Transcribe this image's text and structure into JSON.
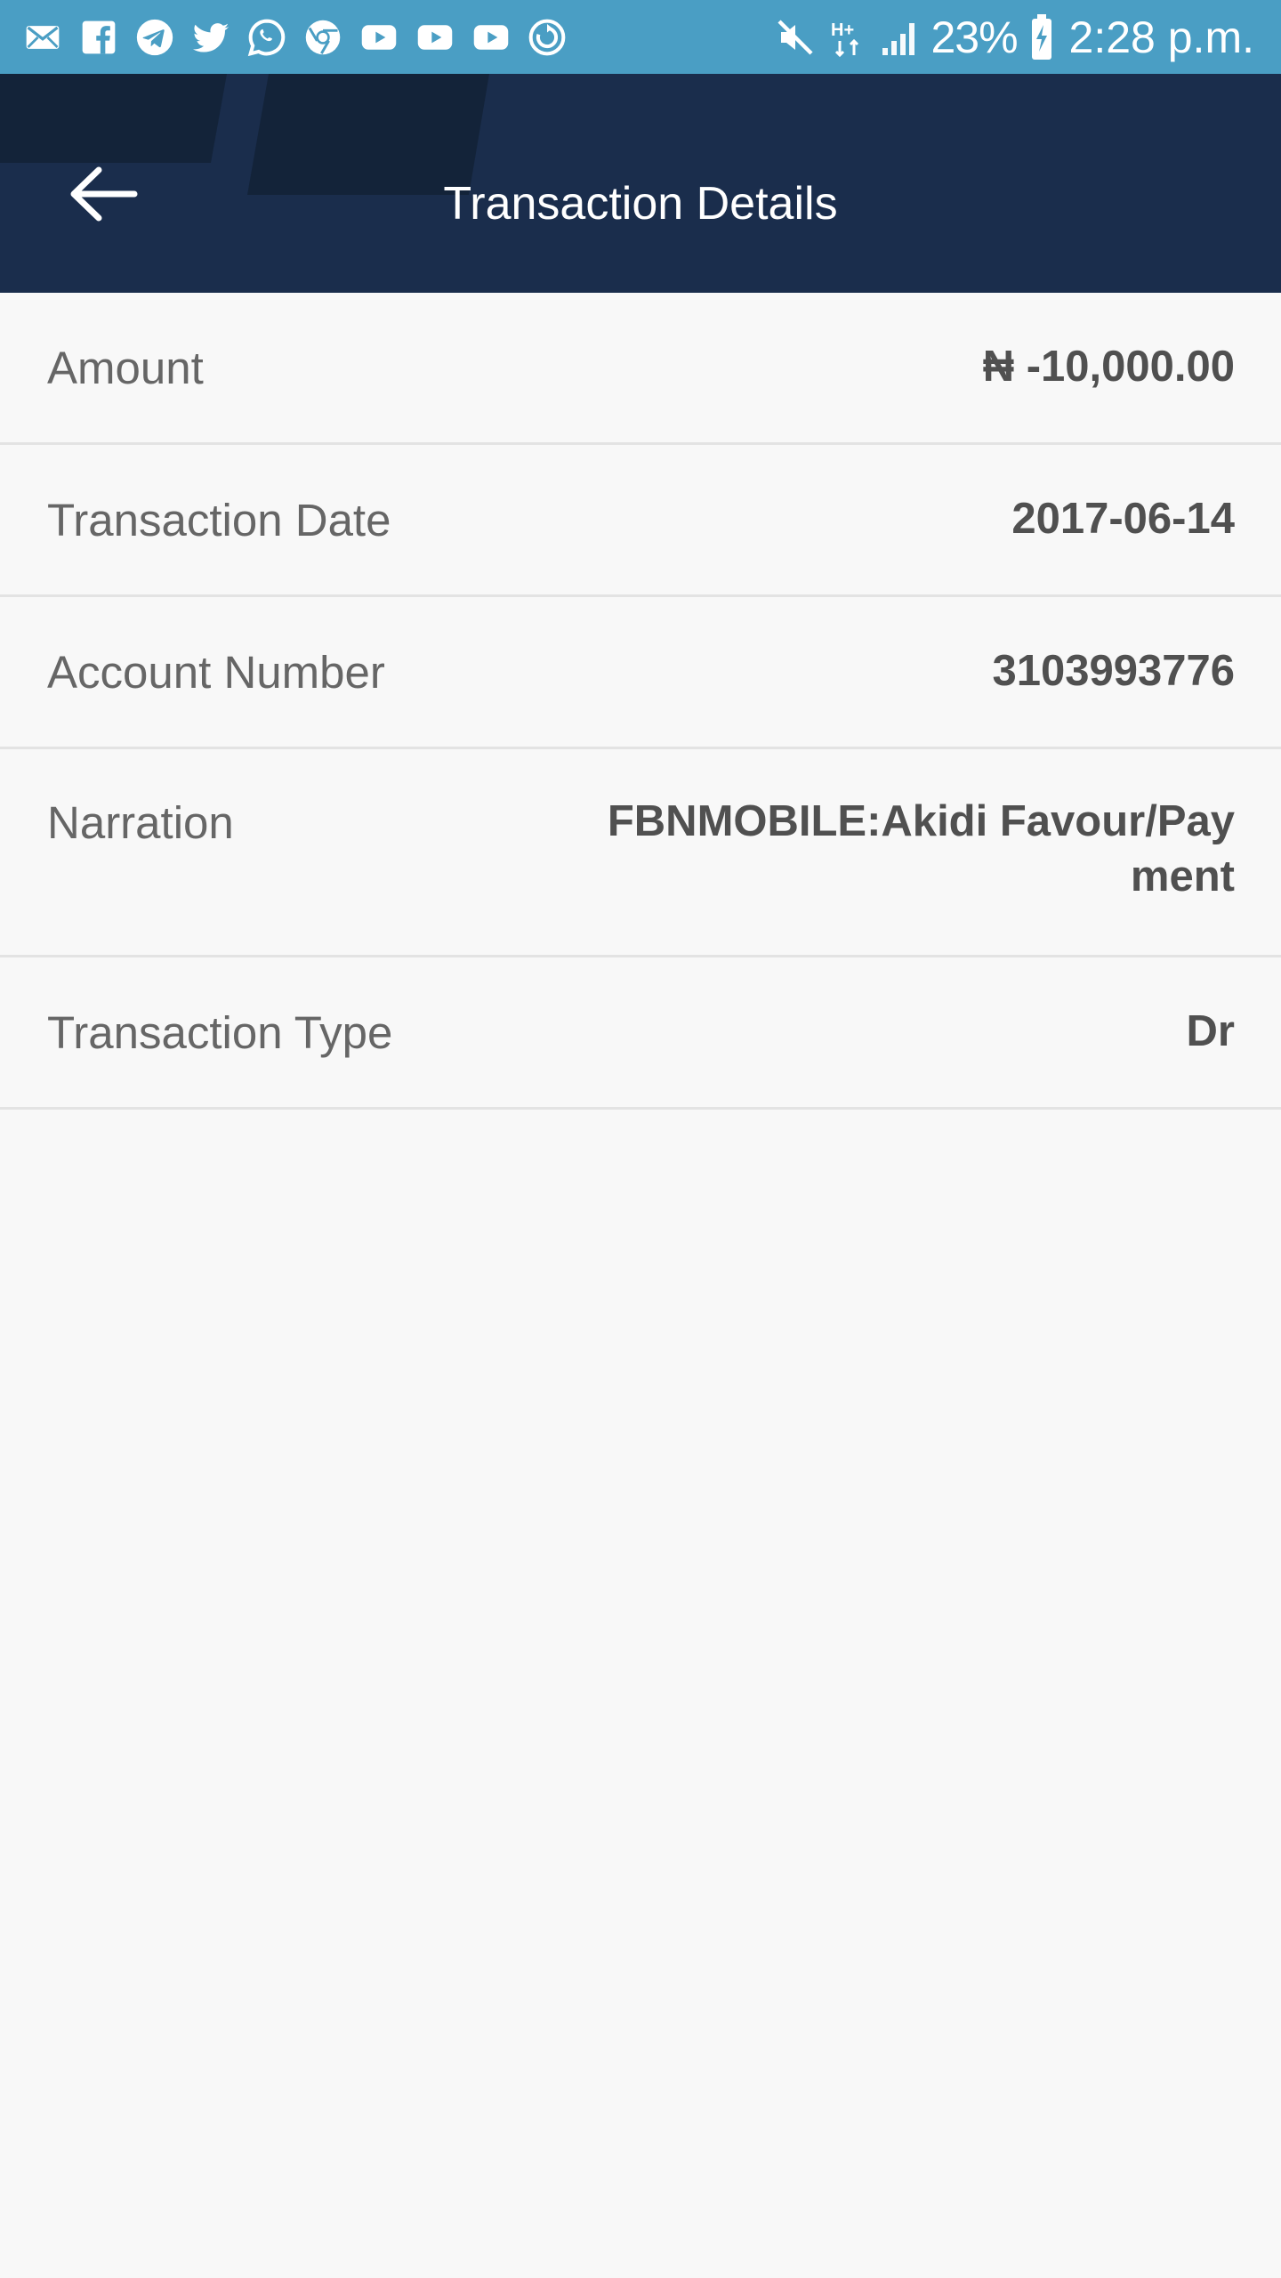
{
  "status_bar": {
    "notification_icons": [
      "email-icon",
      "facebook-icon",
      "telegram-icon",
      "twitter-icon",
      "whatsapp-icon",
      "chrome-icon",
      "youtube-icon",
      "youtube-icon",
      "youtube-icon",
      "sync-icon"
    ],
    "battery_percent": "23%",
    "time": "2:28 p.m."
  },
  "header": {
    "title": "Transaction Details",
    "back_icon": "back-arrow-icon",
    "background_color": "#1a2d4c"
  },
  "details": [
    {
      "label": "Amount",
      "value": "₦ -10,000.00"
    },
    {
      "label": "Transaction Date",
      "value": "2017-06-14"
    },
    {
      "label": "Account Number",
      "value": "3103993776"
    },
    {
      "label": "Narration",
      "value_lines": [
        "FBNMOBILE:Akidi Favour/Pay",
        "ment"
      ]
    },
    {
      "label": "Transaction Type",
      "value": "Dr"
    }
  ],
  "colors": {
    "status_bar": "#4a9ec4",
    "page_background": "#f8f8f8",
    "label_text": "#666666",
    "value_text": "#505050"
  }
}
